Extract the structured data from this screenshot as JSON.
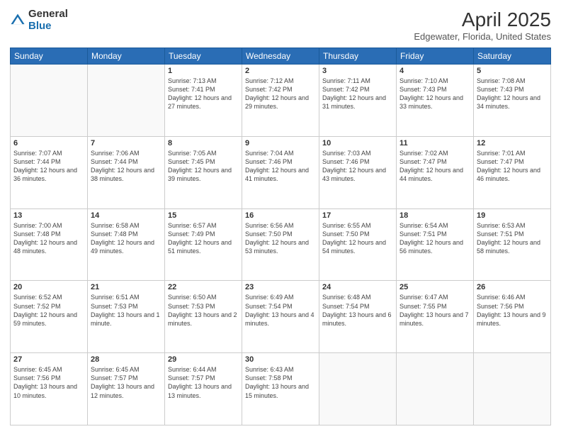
{
  "logo": {
    "general": "General",
    "blue": "Blue"
  },
  "title": {
    "month": "April 2025",
    "location": "Edgewater, Florida, United States"
  },
  "weekdays": [
    "Sunday",
    "Monday",
    "Tuesday",
    "Wednesday",
    "Thursday",
    "Friday",
    "Saturday"
  ],
  "weeks": [
    [
      {
        "day": "",
        "info": ""
      },
      {
        "day": "",
        "info": ""
      },
      {
        "day": "1",
        "info": "Sunrise: 7:13 AM\nSunset: 7:41 PM\nDaylight: 12 hours and 27 minutes."
      },
      {
        "day": "2",
        "info": "Sunrise: 7:12 AM\nSunset: 7:42 PM\nDaylight: 12 hours and 29 minutes."
      },
      {
        "day": "3",
        "info": "Sunrise: 7:11 AM\nSunset: 7:42 PM\nDaylight: 12 hours and 31 minutes."
      },
      {
        "day": "4",
        "info": "Sunrise: 7:10 AM\nSunset: 7:43 PM\nDaylight: 12 hours and 33 minutes."
      },
      {
        "day": "5",
        "info": "Sunrise: 7:08 AM\nSunset: 7:43 PM\nDaylight: 12 hours and 34 minutes."
      }
    ],
    [
      {
        "day": "6",
        "info": "Sunrise: 7:07 AM\nSunset: 7:44 PM\nDaylight: 12 hours and 36 minutes."
      },
      {
        "day": "7",
        "info": "Sunrise: 7:06 AM\nSunset: 7:44 PM\nDaylight: 12 hours and 38 minutes."
      },
      {
        "day": "8",
        "info": "Sunrise: 7:05 AM\nSunset: 7:45 PM\nDaylight: 12 hours and 39 minutes."
      },
      {
        "day": "9",
        "info": "Sunrise: 7:04 AM\nSunset: 7:46 PM\nDaylight: 12 hours and 41 minutes."
      },
      {
        "day": "10",
        "info": "Sunrise: 7:03 AM\nSunset: 7:46 PM\nDaylight: 12 hours and 43 minutes."
      },
      {
        "day": "11",
        "info": "Sunrise: 7:02 AM\nSunset: 7:47 PM\nDaylight: 12 hours and 44 minutes."
      },
      {
        "day": "12",
        "info": "Sunrise: 7:01 AM\nSunset: 7:47 PM\nDaylight: 12 hours and 46 minutes."
      }
    ],
    [
      {
        "day": "13",
        "info": "Sunrise: 7:00 AM\nSunset: 7:48 PM\nDaylight: 12 hours and 48 minutes."
      },
      {
        "day": "14",
        "info": "Sunrise: 6:58 AM\nSunset: 7:48 PM\nDaylight: 12 hours and 49 minutes."
      },
      {
        "day": "15",
        "info": "Sunrise: 6:57 AM\nSunset: 7:49 PM\nDaylight: 12 hours and 51 minutes."
      },
      {
        "day": "16",
        "info": "Sunrise: 6:56 AM\nSunset: 7:50 PM\nDaylight: 12 hours and 53 minutes."
      },
      {
        "day": "17",
        "info": "Sunrise: 6:55 AM\nSunset: 7:50 PM\nDaylight: 12 hours and 54 minutes."
      },
      {
        "day": "18",
        "info": "Sunrise: 6:54 AM\nSunset: 7:51 PM\nDaylight: 12 hours and 56 minutes."
      },
      {
        "day": "19",
        "info": "Sunrise: 6:53 AM\nSunset: 7:51 PM\nDaylight: 12 hours and 58 minutes."
      }
    ],
    [
      {
        "day": "20",
        "info": "Sunrise: 6:52 AM\nSunset: 7:52 PM\nDaylight: 12 hours and 59 minutes."
      },
      {
        "day": "21",
        "info": "Sunrise: 6:51 AM\nSunset: 7:53 PM\nDaylight: 13 hours and 1 minute."
      },
      {
        "day": "22",
        "info": "Sunrise: 6:50 AM\nSunset: 7:53 PM\nDaylight: 13 hours and 2 minutes."
      },
      {
        "day": "23",
        "info": "Sunrise: 6:49 AM\nSunset: 7:54 PM\nDaylight: 13 hours and 4 minutes."
      },
      {
        "day": "24",
        "info": "Sunrise: 6:48 AM\nSunset: 7:54 PM\nDaylight: 13 hours and 6 minutes."
      },
      {
        "day": "25",
        "info": "Sunrise: 6:47 AM\nSunset: 7:55 PM\nDaylight: 13 hours and 7 minutes."
      },
      {
        "day": "26",
        "info": "Sunrise: 6:46 AM\nSunset: 7:56 PM\nDaylight: 13 hours and 9 minutes."
      }
    ],
    [
      {
        "day": "27",
        "info": "Sunrise: 6:45 AM\nSunset: 7:56 PM\nDaylight: 13 hours and 10 minutes."
      },
      {
        "day": "28",
        "info": "Sunrise: 6:45 AM\nSunset: 7:57 PM\nDaylight: 13 hours and 12 minutes."
      },
      {
        "day": "29",
        "info": "Sunrise: 6:44 AM\nSunset: 7:57 PM\nDaylight: 13 hours and 13 minutes."
      },
      {
        "day": "30",
        "info": "Sunrise: 6:43 AM\nSunset: 7:58 PM\nDaylight: 13 hours and 15 minutes."
      },
      {
        "day": "",
        "info": ""
      },
      {
        "day": "",
        "info": ""
      },
      {
        "day": "",
        "info": ""
      }
    ]
  ]
}
